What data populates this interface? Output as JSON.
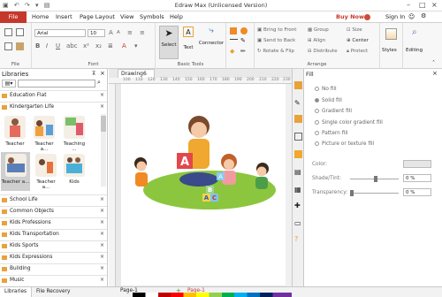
{
  "window": {
    "title": "Edraw Max (Unlicensed Version)",
    "quick_access": "▣ ↶ ↷ ▾ ▤"
  },
  "menu": {
    "file": "File",
    "items": [
      "Home",
      "Insert",
      "Page Layout",
      "View",
      "Symbols",
      "Help"
    ],
    "buy_now": "Buy Now",
    "sign_in": "Sign In"
  },
  "ribbon": {
    "file_group_label": "File",
    "font": {
      "family": "Arial",
      "size": "10",
      "label": "Font"
    },
    "basic_tools": {
      "select": "Select",
      "text": "Text",
      "connector": "Connector",
      "label": "Basic Tools"
    },
    "arrange": {
      "bring_to_front": "Bring to Front",
      "send_to_back": "Send to Back",
      "rotate_flip": "Rotate & Flip",
      "group": "Group",
      "align": "Align",
      "distribute": "Distribute",
      "size": "Size",
      "center": "Center",
      "protect": "Protect",
      "label": "Arrange"
    },
    "styles": "Styles",
    "editing": "Editing"
  },
  "libraries": {
    "title": "Libraries",
    "search_placeholder": "",
    "open_categories": [
      "Education Flat",
      "Kindergarten Life"
    ],
    "shapes": [
      "Teacher",
      "Teacher a...",
      "Teaching ...",
      "Teacher a...",
      "Teacher a...",
      "Kids"
    ],
    "categories": [
      "School Life",
      "Common Objects",
      "Kids Professions",
      "Kids Transportation",
      "Kids Sports",
      "Kids Expressions",
      "Building",
      "Music"
    ]
  },
  "canvas": {
    "tab": "Drawing6",
    "ruler_marks": [
      "100",
      "110",
      "120",
      "130",
      "140",
      "150",
      "160",
      "170",
      "180",
      "190",
      "200",
      "210",
      "220",
      "230"
    ],
    "illustration_letters": [
      "A",
      "A",
      "B",
      "C"
    ]
  },
  "fill_panel": {
    "title": "Fill",
    "options": [
      "No fill",
      "Solid fill",
      "Gradient fill",
      "Single color gradient fill",
      "Pattern fill",
      "Picture or texture fill"
    ],
    "selected": "Solid fill",
    "color_label": "Color:",
    "shade_label": "Shade/Tint:",
    "shade_value": "0 %",
    "transparency_label": "Transparency:",
    "transparency_value": "0 %"
  },
  "bottom": {
    "tabs": [
      "Libraries",
      "File Recovery"
    ],
    "page_tabs": [
      "Page-1",
      "Page-1"
    ],
    "add_page": "+"
  },
  "colors": {
    "accent": "#c6372b",
    "orange": "#e9a13b",
    "grass": "#8cc63e",
    "palette": [
      "#000000",
      "#ffffff",
      "#c00000",
      "#ff0000",
      "#ffc000",
      "#ffff00",
      "#92d050",
      "#00b050",
      "#00b0f0",
      "#0070c0",
      "#002060",
      "#7030a0"
    ]
  }
}
